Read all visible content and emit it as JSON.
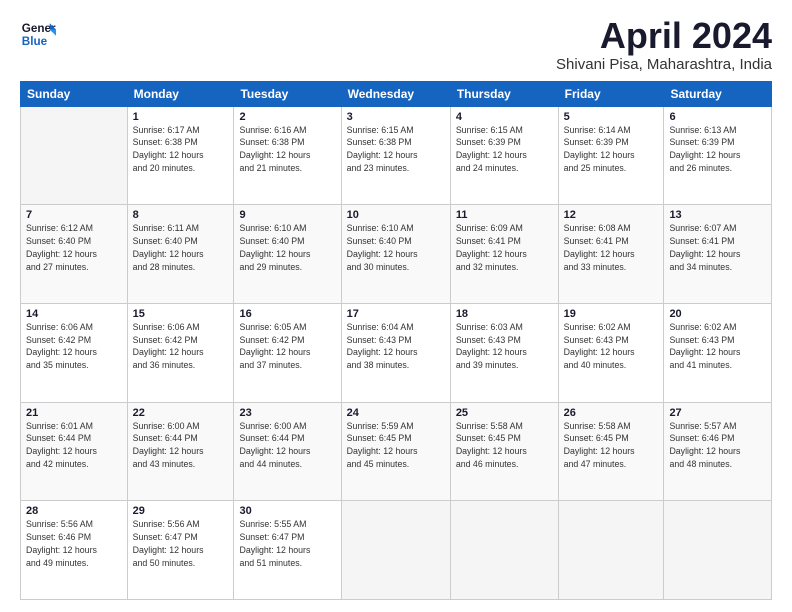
{
  "header": {
    "logo_line1": "General",
    "logo_line2": "Blue",
    "month": "April 2024",
    "location": "Shivani Pisa, Maharashtra, India"
  },
  "days_of_week": [
    "Sunday",
    "Monday",
    "Tuesday",
    "Wednesday",
    "Thursday",
    "Friday",
    "Saturday"
  ],
  "weeks": [
    [
      {
        "date": "",
        "info": ""
      },
      {
        "date": "1",
        "info": "Sunrise: 6:17 AM\nSunset: 6:38 PM\nDaylight: 12 hours\nand 20 minutes."
      },
      {
        "date": "2",
        "info": "Sunrise: 6:16 AM\nSunset: 6:38 PM\nDaylight: 12 hours\nand 21 minutes."
      },
      {
        "date": "3",
        "info": "Sunrise: 6:15 AM\nSunset: 6:38 PM\nDaylight: 12 hours\nand 23 minutes."
      },
      {
        "date": "4",
        "info": "Sunrise: 6:15 AM\nSunset: 6:39 PM\nDaylight: 12 hours\nand 24 minutes."
      },
      {
        "date": "5",
        "info": "Sunrise: 6:14 AM\nSunset: 6:39 PM\nDaylight: 12 hours\nand 25 minutes."
      },
      {
        "date": "6",
        "info": "Sunrise: 6:13 AM\nSunset: 6:39 PM\nDaylight: 12 hours\nand 26 minutes."
      }
    ],
    [
      {
        "date": "7",
        "info": "Sunrise: 6:12 AM\nSunset: 6:40 PM\nDaylight: 12 hours\nand 27 minutes."
      },
      {
        "date": "8",
        "info": "Sunrise: 6:11 AM\nSunset: 6:40 PM\nDaylight: 12 hours\nand 28 minutes."
      },
      {
        "date": "9",
        "info": "Sunrise: 6:10 AM\nSunset: 6:40 PM\nDaylight: 12 hours\nand 29 minutes."
      },
      {
        "date": "10",
        "info": "Sunrise: 6:10 AM\nSunset: 6:40 PM\nDaylight: 12 hours\nand 30 minutes."
      },
      {
        "date": "11",
        "info": "Sunrise: 6:09 AM\nSunset: 6:41 PM\nDaylight: 12 hours\nand 32 minutes."
      },
      {
        "date": "12",
        "info": "Sunrise: 6:08 AM\nSunset: 6:41 PM\nDaylight: 12 hours\nand 33 minutes."
      },
      {
        "date": "13",
        "info": "Sunrise: 6:07 AM\nSunset: 6:41 PM\nDaylight: 12 hours\nand 34 minutes."
      }
    ],
    [
      {
        "date": "14",
        "info": "Sunrise: 6:06 AM\nSunset: 6:42 PM\nDaylight: 12 hours\nand 35 minutes."
      },
      {
        "date": "15",
        "info": "Sunrise: 6:06 AM\nSunset: 6:42 PM\nDaylight: 12 hours\nand 36 minutes."
      },
      {
        "date": "16",
        "info": "Sunrise: 6:05 AM\nSunset: 6:42 PM\nDaylight: 12 hours\nand 37 minutes."
      },
      {
        "date": "17",
        "info": "Sunrise: 6:04 AM\nSunset: 6:43 PM\nDaylight: 12 hours\nand 38 minutes."
      },
      {
        "date": "18",
        "info": "Sunrise: 6:03 AM\nSunset: 6:43 PM\nDaylight: 12 hours\nand 39 minutes."
      },
      {
        "date": "19",
        "info": "Sunrise: 6:02 AM\nSunset: 6:43 PM\nDaylight: 12 hours\nand 40 minutes."
      },
      {
        "date": "20",
        "info": "Sunrise: 6:02 AM\nSunset: 6:43 PM\nDaylight: 12 hours\nand 41 minutes."
      }
    ],
    [
      {
        "date": "21",
        "info": "Sunrise: 6:01 AM\nSunset: 6:44 PM\nDaylight: 12 hours\nand 42 minutes."
      },
      {
        "date": "22",
        "info": "Sunrise: 6:00 AM\nSunset: 6:44 PM\nDaylight: 12 hours\nand 43 minutes."
      },
      {
        "date": "23",
        "info": "Sunrise: 6:00 AM\nSunset: 6:44 PM\nDaylight: 12 hours\nand 44 minutes."
      },
      {
        "date": "24",
        "info": "Sunrise: 5:59 AM\nSunset: 6:45 PM\nDaylight: 12 hours\nand 45 minutes."
      },
      {
        "date": "25",
        "info": "Sunrise: 5:58 AM\nSunset: 6:45 PM\nDaylight: 12 hours\nand 46 minutes."
      },
      {
        "date": "26",
        "info": "Sunrise: 5:58 AM\nSunset: 6:45 PM\nDaylight: 12 hours\nand 47 minutes."
      },
      {
        "date": "27",
        "info": "Sunrise: 5:57 AM\nSunset: 6:46 PM\nDaylight: 12 hours\nand 48 minutes."
      }
    ],
    [
      {
        "date": "28",
        "info": "Sunrise: 5:56 AM\nSunset: 6:46 PM\nDaylight: 12 hours\nand 49 minutes."
      },
      {
        "date": "29",
        "info": "Sunrise: 5:56 AM\nSunset: 6:47 PM\nDaylight: 12 hours\nand 50 minutes."
      },
      {
        "date": "30",
        "info": "Sunrise: 5:55 AM\nSunset: 6:47 PM\nDaylight: 12 hours\nand 51 minutes."
      },
      {
        "date": "",
        "info": ""
      },
      {
        "date": "",
        "info": ""
      },
      {
        "date": "",
        "info": ""
      },
      {
        "date": "",
        "info": ""
      }
    ]
  ]
}
